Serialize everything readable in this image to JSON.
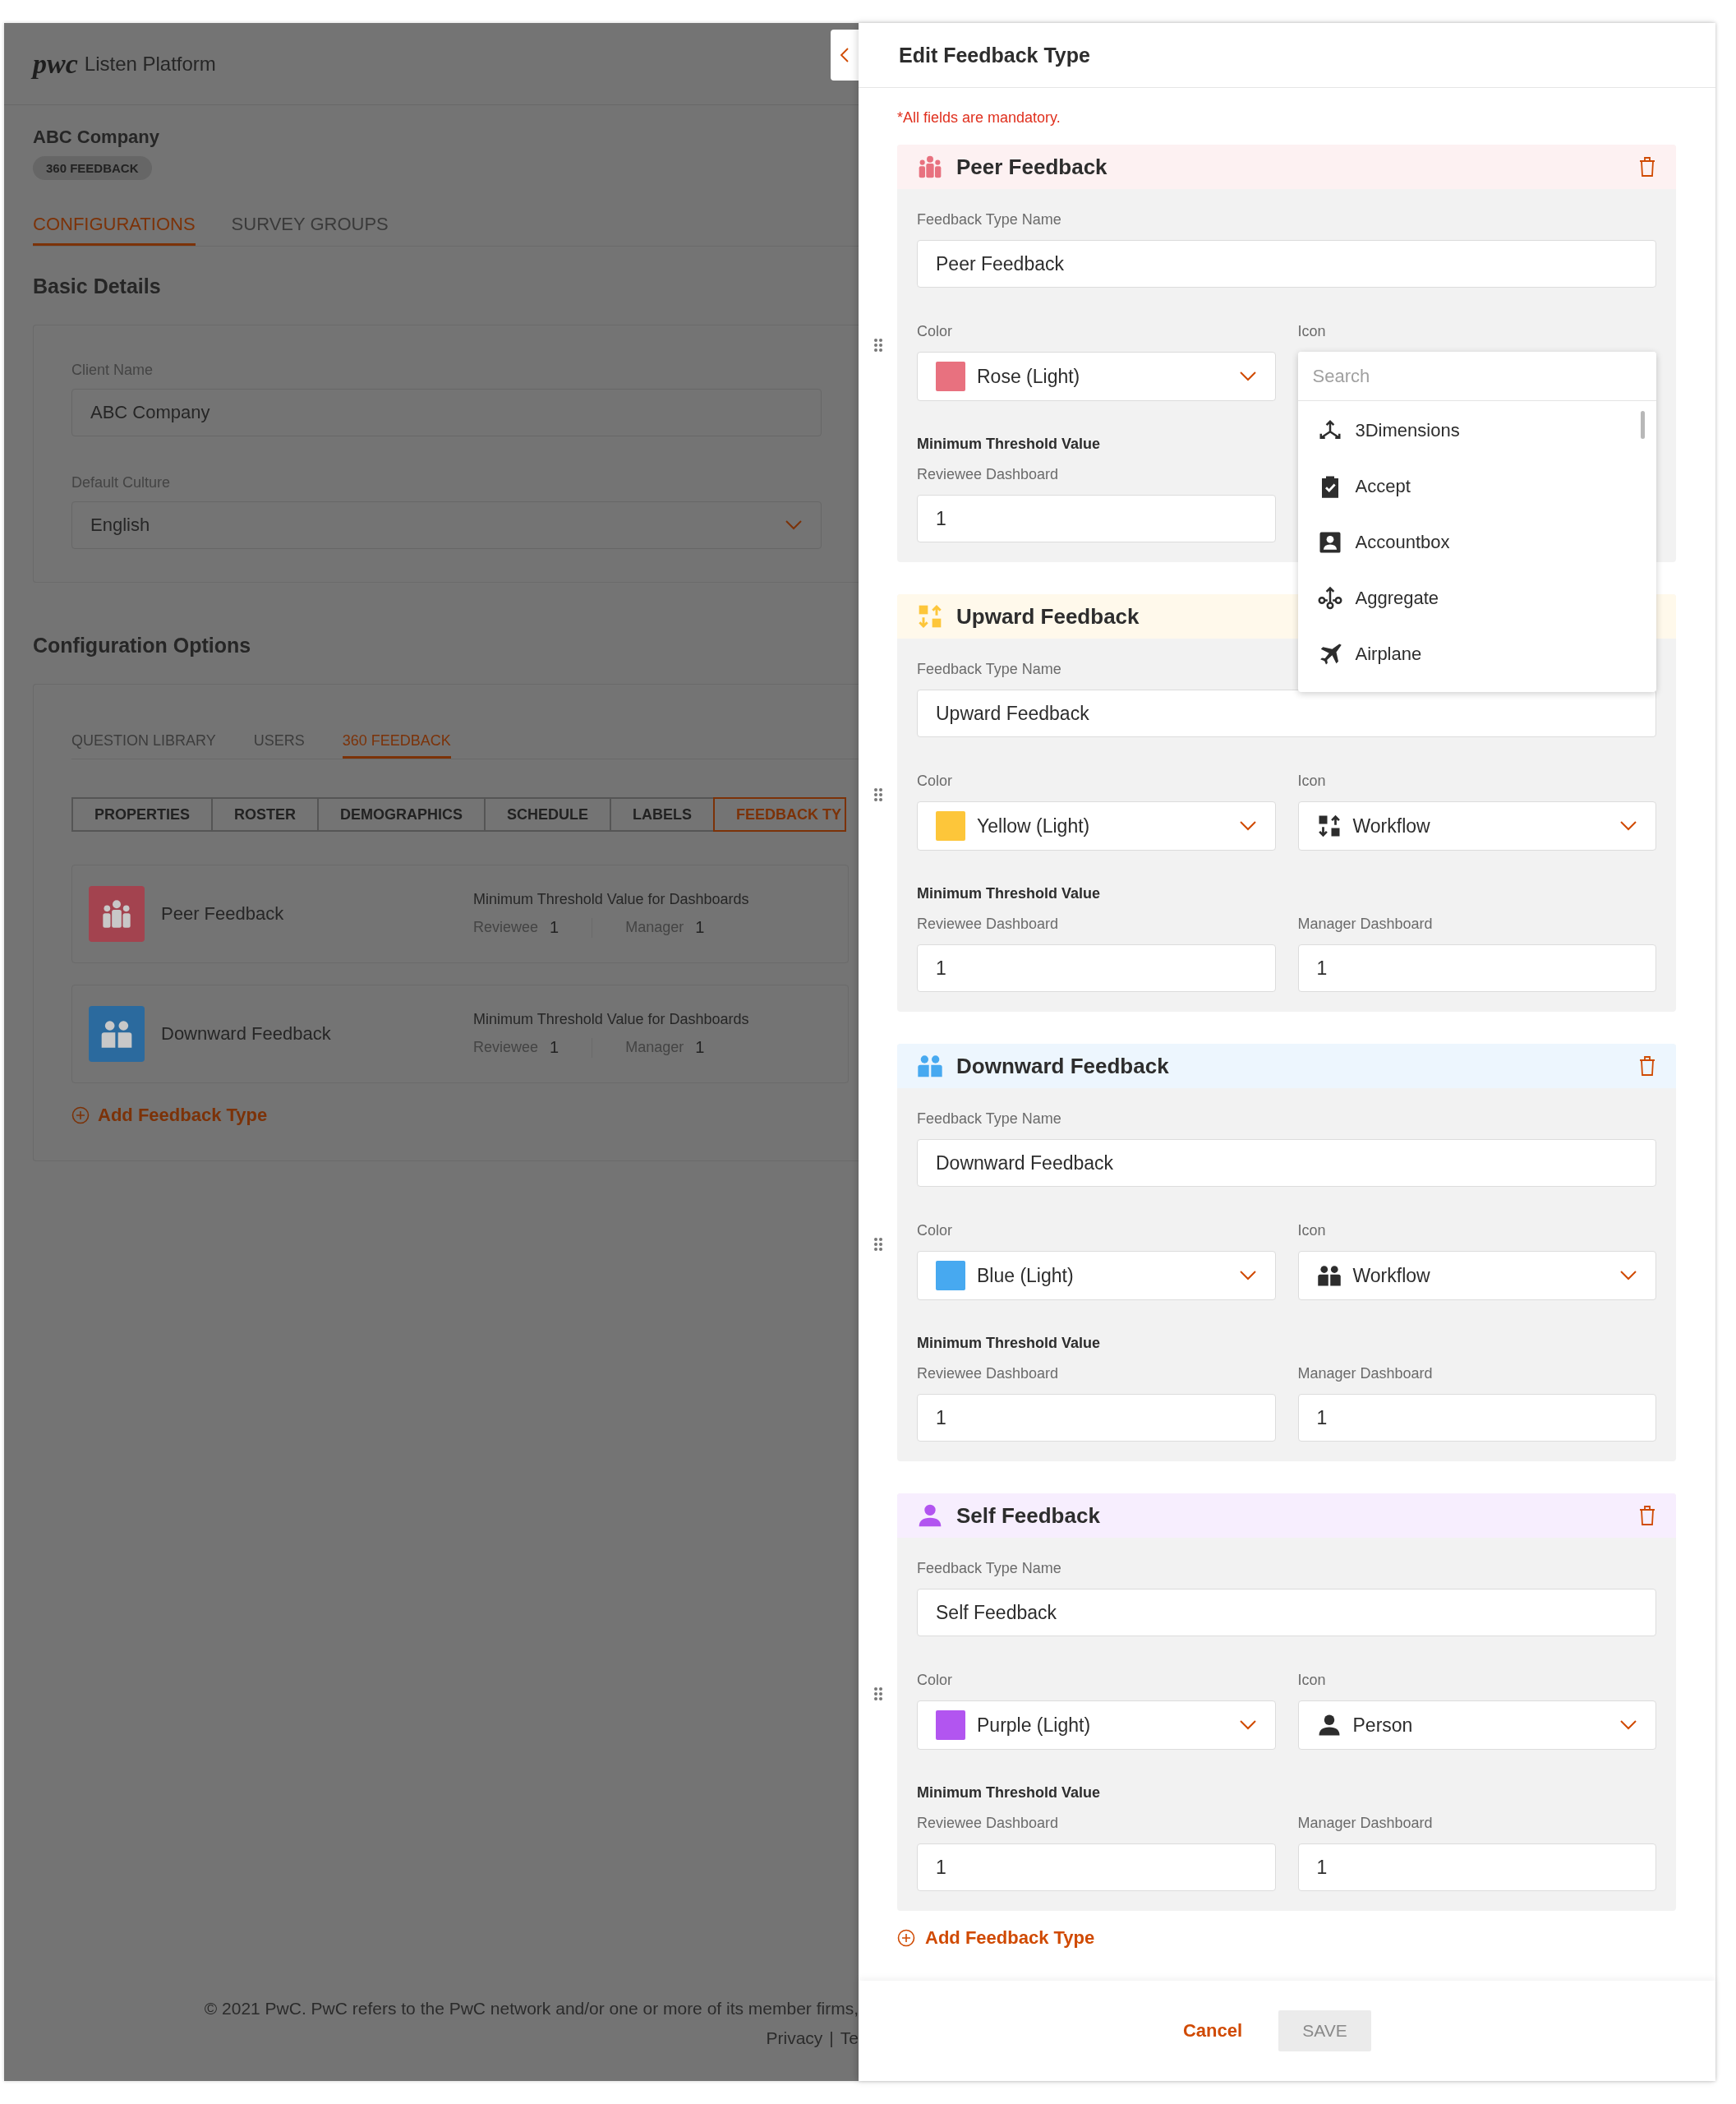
{
  "app": {
    "logo": "pwc",
    "title": "Listen Platform"
  },
  "client": {
    "name": "ABC Company",
    "chip": "360 FEEDBACK"
  },
  "main_tabs": [
    {
      "label": "CONFIGURATIONS",
      "selected": true
    },
    {
      "label": "SURVEY GROUPS",
      "selected": false
    }
  ],
  "basic_details": {
    "heading": "Basic Details",
    "client_name": {
      "label": "Client Name",
      "value": "ABC Company"
    },
    "default_culture": {
      "label": "Default Culture",
      "value": "English"
    }
  },
  "configuration_options": {
    "heading": "Configuration Options",
    "tabs": [
      {
        "label": "QUESTION LIBRARY",
        "selected": false
      },
      {
        "label": "USERS",
        "selected": false
      },
      {
        "label": "360 FEEDBACK",
        "selected": true
      }
    ],
    "segments": [
      {
        "label": "PROPERTIES",
        "selected": false
      },
      {
        "label": "ROSTER",
        "selected": false
      },
      {
        "label": "DEMOGRAPHICS",
        "selected": false
      },
      {
        "label": "SCHEDULE",
        "selected": false
      },
      {
        "label": "LABELS",
        "selected": false
      },
      {
        "label": "FEEDBACK TY",
        "selected": true
      }
    ],
    "feedback_types": [
      {
        "name": "Peer Feedback",
        "kind": "group",
        "color": "#a3434f",
        "threshold_heading": "Minimum Threshold Value for Dashboards",
        "reviewee_label": "Reviewee",
        "reviewee_value": "1",
        "manager_label": "Manager",
        "manager_value": "1"
      },
      {
        "name": "Downward Feedback",
        "kind": "pair",
        "color": "#2b6a9e",
        "threshold_heading": "Minimum Threshold Value for Dashboards",
        "reviewee_label": "Reviewee",
        "reviewee_value": "1",
        "manager_label": "Manager",
        "manager_value": "1"
      }
    ],
    "add_link": "Add Feedback Type"
  },
  "footer": {
    "copyright": "© 2021 PwC. PwC refers to the PwC network and/or one or more of its member firms,",
    "links": [
      "Privacy",
      "Te"
    ],
    "separator": "|"
  },
  "drawer": {
    "title": "Edit Feedback Type",
    "note": "*All fields are mandatory.",
    "cards": [
      {
        "title": "Peer Feedback",
        "kind": "group",
        "color": "#e8717f",
        "deletable": true,
        "name_label": "Feedback Type Name",
        "name_value": "Peer Feedback",
        "color_label": "Color",
        "color_value": "Rose (Light)",
        "icon_label": "Icon",
        "icon_field": {
          "open": true,
          "placeholder": "Search",
          "options": [
            {
              "label": "3Dimensions",
              "kind": "dimensions"
            },
            {
              "label": "Accept",
              "kind": "accept"
            },
            {
              "label": "Accountbox",
              "kind": "accountbox"
            },
            {
              "label": "Aggregate",
              "kind": "aggregate"
            },
            {
              "label": "Airplane",
              "kind": "airplane"
            }
          ]
        },
        "threshold_heading": "Minimum Threshold Value",
        "thresholds": [
          {
            "label": "Reviewee Dashboard",
            "value": "1"
          }
        ]
      },
      {
        "title": "Upward Feedback",
        "kind": "updown",
        "color": "#fdc63a",
        "name_label": "Feedback Type Name",
        "name_value": "Upward Feedback",
        "color_label": "Color",
        "color_value": "Yellow (Light)",
        "icon_label": "Icon",
        "icon_field": {
          "open": false,
          "value": "Workflow",
          "kind": "updown"
        },
        "threshold_heading": "Minimum Threshold Value",
        "thresholds": [
          {
            "label": "Reviewee Dashboard",
            "value": "1"
          },
          {
            "label": "Manager Dashboard",
            "value": "1"
          }
        ]
      },
      {
        "title": "Downward Feedback",
        "kind": "pair",
        "color": "#47a9f0",
        "deletable": true,
        "name_label": "Feedback Type Name",
        "name_value": "Downward Feedback",
        "color_label": "Color",
        "color_value": "Blue (Light)",
        "icon_label": "Icon",
        "icon_field": {
          "open": false,
          "value": "Workflow",
          "kind": "pair"
        },
        "threshold_heading": "Minimum Threshold Value",
        "thresholds": [
          {
            "label": "Reviewee Dashboard",
            "value": "1"
          },
          {
            "label": "Manager Dashboard",
            "value": "1"
          }
        ]
      },
      {
        "title": "Self Feedback",
        "kind": "person",
        "color": "#b255f0",
        "deletable": true,
        "name_label": "Feedback Type Name",
        "name_value": "Self Feedback",
        "color_label": "Color",
        "color_value": "Purple (Light)",
        "icon_label": "Icon",
        "icon_field": {
          "open": false,
          "value": "Person",
          "kind": "person"
        },
        "threshold_heading": "Minimum Threshold Value",
        "thresholds": [
          {
            "label": "Reviewee Dashboard",
            "value": "1"
          },
          {
            "label": "Manager Dashboard",
            "value": "1"
          }
        ]
      }
    ],
    "add_link": "Add Feedback Type",
    "cancel": "Cancel",
    "save": "SAVE",
    "save_disabled": true
  }
}
